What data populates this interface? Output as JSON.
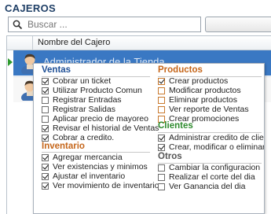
{
  "title": "CAJEROS",
  "search": {
    "placeholder": "Buscar ..."
  },
  "grid": {
    "column_header": "Nombre del Cajero",
    "rows": [
      {
        "name": "Administrador de la Tienda",
        "selected": true
      },
      {
        "name": "",
        "selected": false
      }
    ]
  },
  "permissions": {
    "ventas": {
      "title": "Ventas",
      "items": [
        {
          "label": "Cobrar un ticket",
          "checked": true
        },
        {
          "label": "Utilizar Producto Comun",
          "checked": true
        },
        {
          "label": "Registrar Entradas",
          "checked": false
        },
        {
          "label": "Registrar Salidas",
          "checked": false
        },
        {
          "label": "Aplicar precio de mayoreo",
          "checked": false
        },
        {
          "label": "Revisar el historial de Ventas",
          "checked": true
        },
        {
          "label": "Cobrar a credito.",
          "checked": true
        }
      ]
    },
    "inventario": {
      "title": "Inventario",
      "items": [
        {
          "label": "Agregar mercancia",
          "checked": true
        },
        {
          "label": "Ver existencias y minimos",
          "checked": true
        },
        {
          "label": "Ajustar el inventario",
          "checked": true
        },
        {
          "label": "Ver movimiento de inventarios",
          "checked": true
        }
      ]
    },
    "productos": {
      "title": "Productos",
      "items": [
        {
          "label": "Crear productos",
          "checked": true
        },
        {
          "label": "Modificar  productos",
          "checked": false
        },
        {
          "label": "Eliminar productos",
          "checked": false
        },
        {
          "label": "Ver reporte de Ventas",
          "checked": false
        },
        {
          "label": "Crear promociones",
          "checked": false
        }
      ]
    },
    "clientes": {
      "title": "Clientes",
      "items": [
        {
          "label": "Administrar credito de clientes",
          "checked": true
        },
        {
          "label": "Crear, modificar o eliminar clientes",
          "checked": true
        }
      ]
    },
    "otros": {
      "title": "Otros",
      "items": [
        {
          "label": "Cambiar la configuracion",
          "checked": false
        },
        {
          "label": "Realizar el corte del dia",
          "checked": false
        },
        {
          "label": "Ver Ganancia del dia",
          "checked": false
        }
      ]
    }
  },
  "colors": {
    "selected_row": "#3a78c3",
    "ventas_heading": "#1e4f95",
    "inventario_heading": "#c5661a",
    "productos_heading": "#c5661a",
    "clientes_heading": "#2d8a2d"
  }
}
